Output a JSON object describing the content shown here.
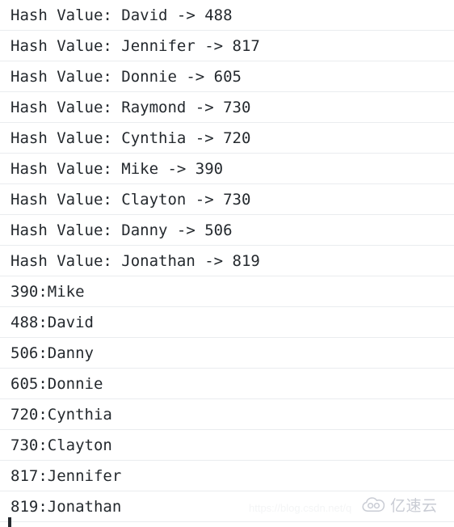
{
  "console": {
    "lines": [
      {
        "text": "Hash Value: David -> 488"
      },
      {
        "text": "Hash Value: Jennifer -> 817"
      },
      {
        "text": "Hash Value: Donnie -> 605"
      },
      {
        "text": "Hash Value: Raymond -> 730"
      },
      {
        "text": "Hash Value: Cynthia -> 720"
      },
      {
        "text": "Hash Value: Mike -> 390"
      },
      {
        "text": "Hash Value: Clayton -> 730"
      },
      {
        "text": "Hash Value: Danny -> 506"
      },
      {
        "text": "Hash Value: Jonathan -> 819"
      },
      {
        "text": "390:Mike"
      },
      {
        "text": "488:David"
      },
      {
        "text": "506:Danny"
      },
      {
        "text": "605:Donnie"
      },
      {
        "text": "720:Cynthia"
      },
      {
        "text": "730:Clayton"
      },
      {
        "text": "817:Jennifer"
      },
      {
        "text": "819:Jonathan"
      }
    ],
    "text_color": "#24292e",
    "background_color": "#ffffff",
    "separator_color": "#eaecef",
    "caret_color": "#24292e"
  },
  "watermarks": {
    "url": "https://blog.csdn.net/q",
    "url_color": "#f4f5f6",
    "brand": "亿速云",
    "brand_color": "#c9ccd4",
    "brand_icon": "cloud-icon"
  }
}
